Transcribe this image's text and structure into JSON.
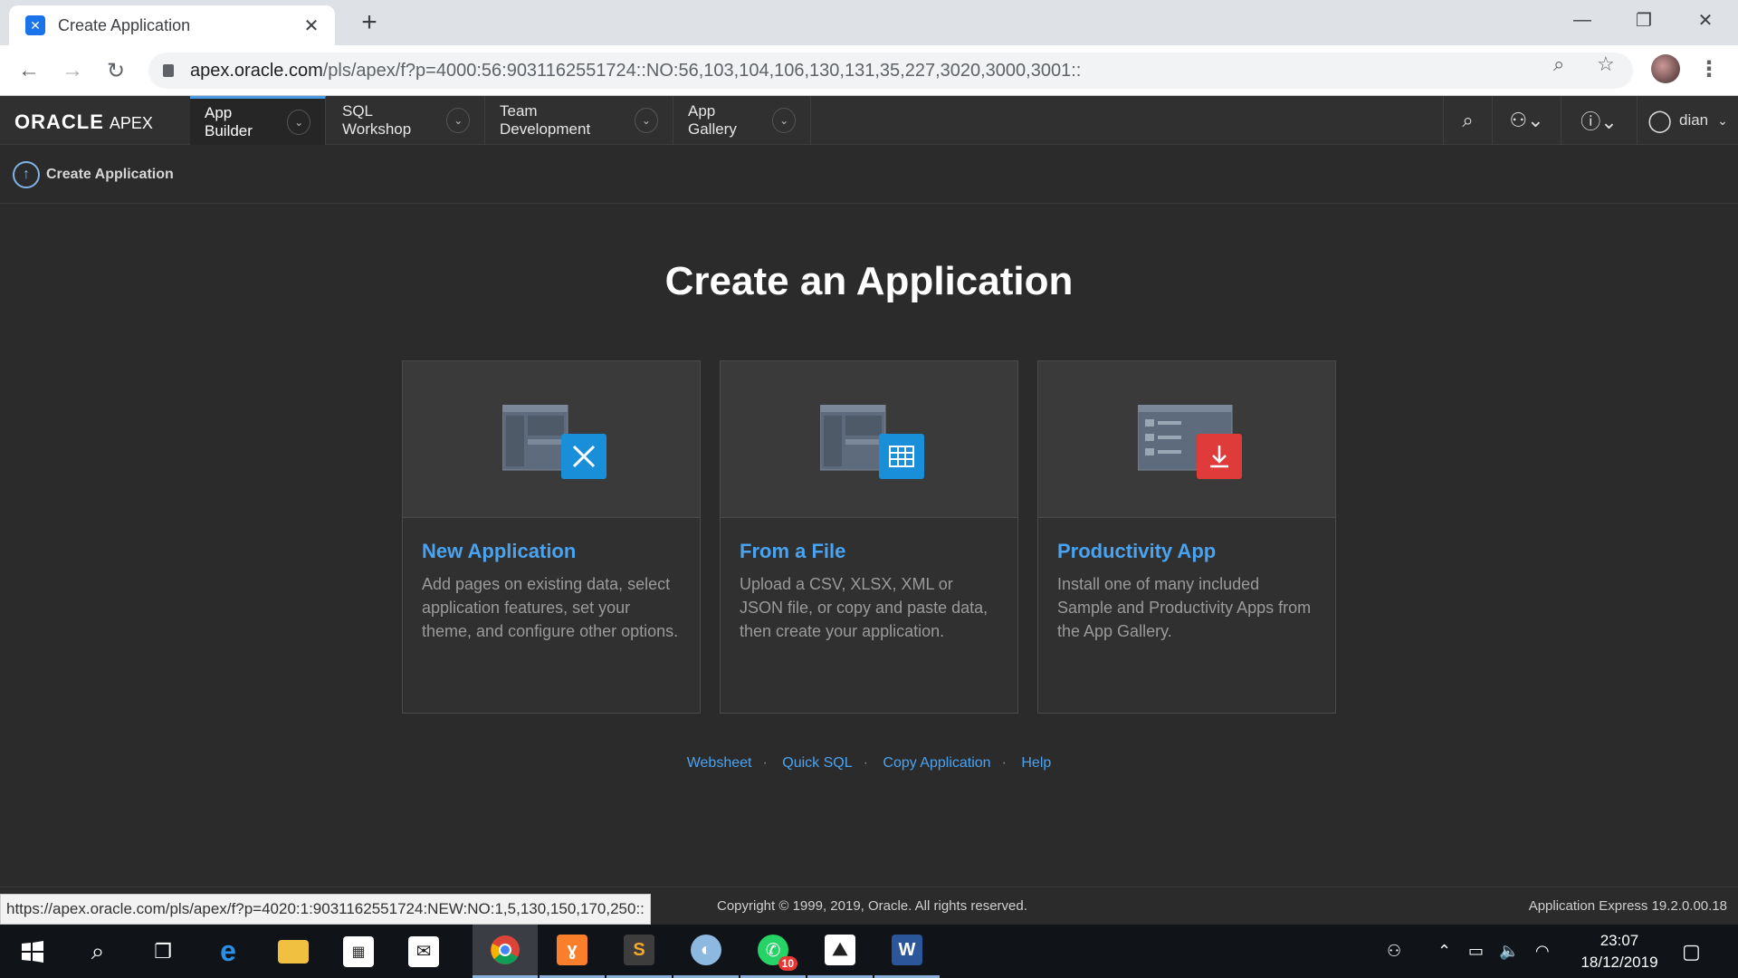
{
  "browser": {
    "tab_title": "Create Application",
    "tab_favicon": "apex-icon",
    "url_host": "apex.oracle.com",
    "url_path": "/pls/apex/f?p=4000:56:9031162551724::NO:56,103,104,106,130,131,35,227,3020,3000,3001::",
    "status_url": "https://apex.oracle.com/pls/apex/f?p=4020:1:9031162551724:NEW:NO:1,5,130,150,170,250::"
  },
  "apex": {
    "logo_main": "ORACLE",
    "logo_sub": "APEX",
    "nav_tabs": [
      {
        "label": "App Builder"
      },
      {
        "label": "SQL Workshop"
      },
      {
        "label": "Team Development"
      },
      {
        "label": "App Gallery"
      }
    ],
    "user_name": "dian",
    "breadcrumb": "Create Application"
  },
  "main": {
    "title": "Create an Application",
    "cards": [
      {
        "title": "New Application",
        "description": "Add pages on existing data, select application features, set your theme, and configure other options.",
        "icon": "wrench-pencil-icon",
        "accent": "#1a8fd9"
      },
      {
        "title": "From a File",
        "description": "Upload a CSV, XLSX, XML or JSON file, or copy and paste data, then create your application.",
        "icon": "grid-icon",
        "accent": "#1a8fd9"
      },
      {
        "title": "Productivity App",
        "description": "Install one of many included Sample and Productivity Apps from the App Gallery.",
        "icon": "download-icon",
        "accent": "#e03b3b"
      }
    ],
    "links": [
      "Websheet",
      "Quick SQL",
      "Copy Application",
      "Help"
    ]
  },
  "footer": {
    "copyright": "Copyright © 1999, 2019, Oracle. All rights reserved.",
    "version": "Application Express 19.2.0.00.18"
  },
  "taskbar": {
    "time": "23:07",
    "date": "18/12/2019",
    "whatsapp_badge": "10"
  }
}
